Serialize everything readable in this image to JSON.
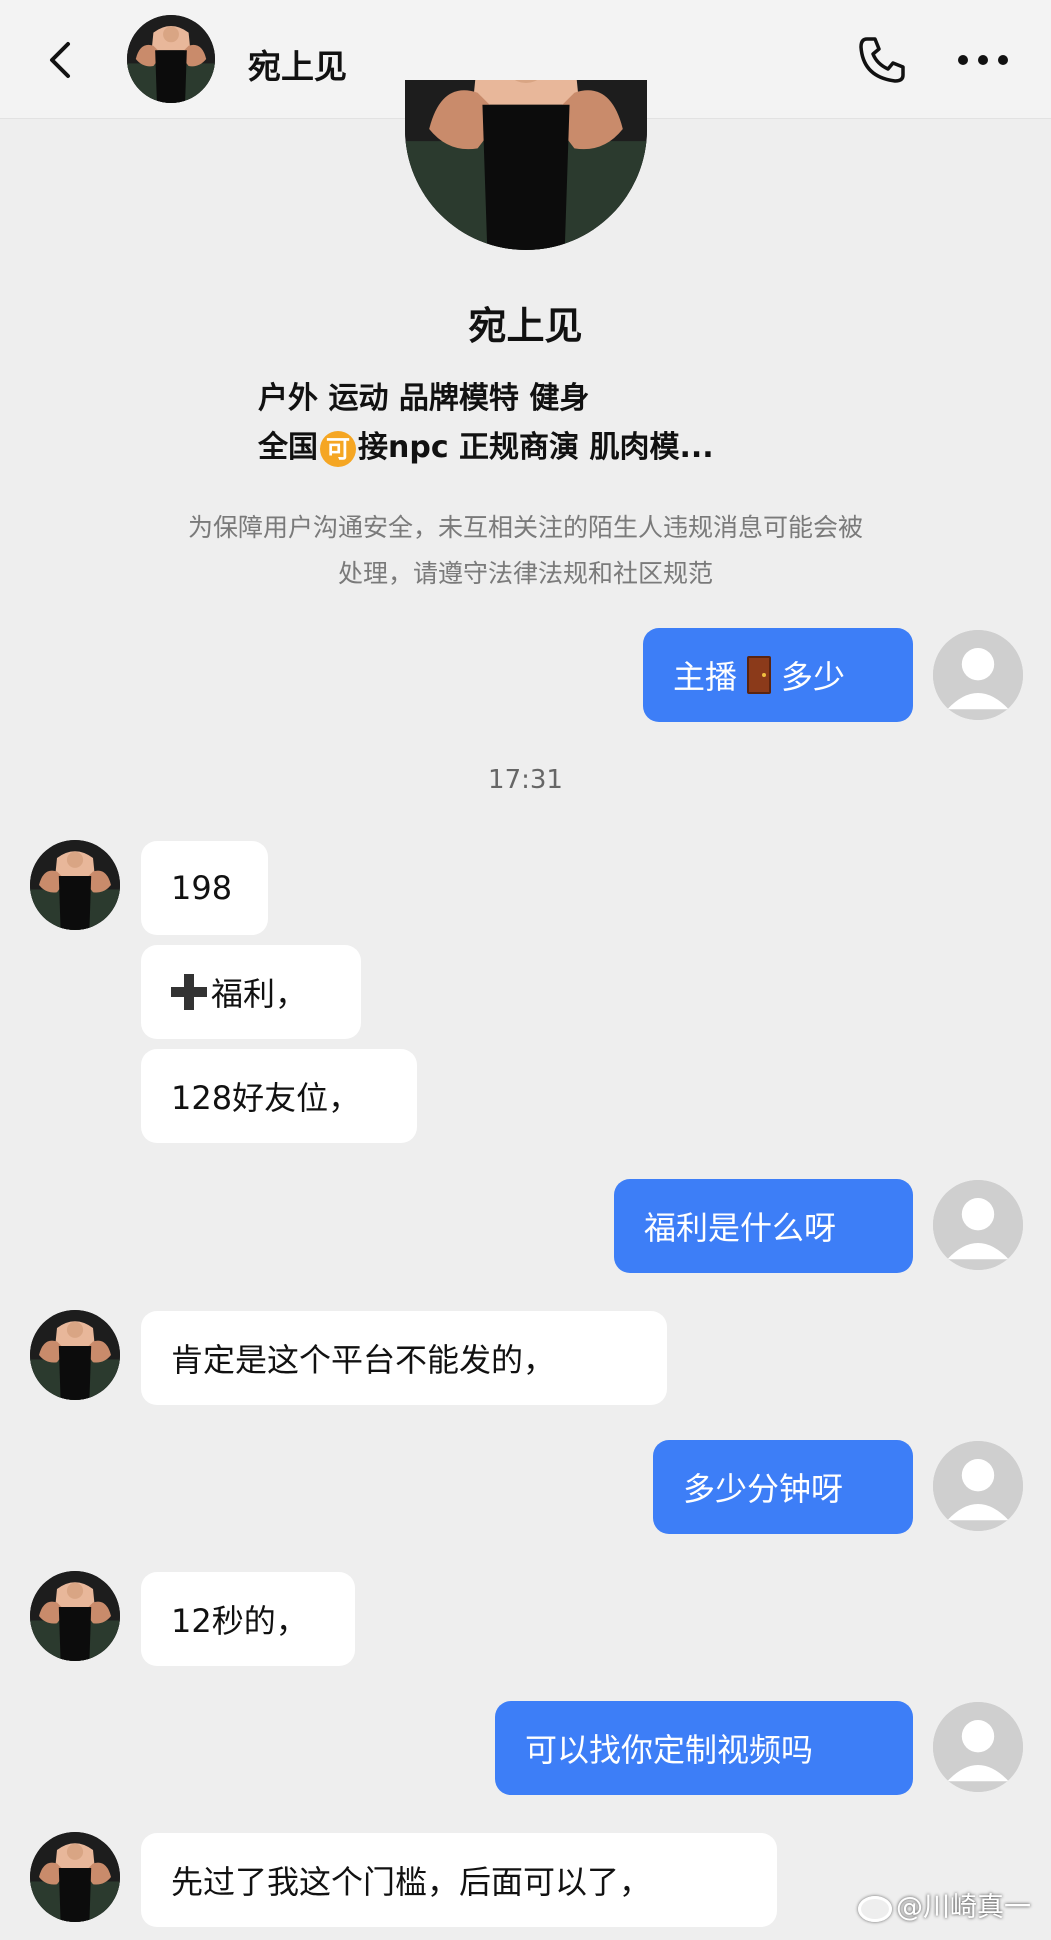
{
  "header": {
    "title": "宛上见",
    "back_icon": "chevron-left-icon",
    "call_icon": "phone-icon",
    "more_icon": "more-dots-icon"
  },
  "profile": {
    "name": "宛上见",
    "bio_line1": "户外 运动 品牌模特 健身",
    "bio_line2_prefix": "全国",
    "bio_badge": "可",
    "bio_line2_suffix": "接npc 正规商演 肌肉模...",
    "badge_color": "#f5a623"
  },
  "notice": {
    "line1": "为保障用户沟通安全，未互相关注的陌生人违规消息可能会被",
    "line2": "处理，请遵守法律法规和社区规范"
  },
  "messages": {
    "m1_before": "主播",
    "m1_after": "多少",
    "time": "17:31",
    "m2": "198",
    "m3": "福利，",
    "m4": "128好友位，",
    "m5": "福利是什么呀",
    "m6": "肯定是这个平台不能发的，",
    "m7": "多少分钟呀",
    "m8": "12秒的，",
    "m9": "可以找你定制视频吗",
    "m10": "先过了我这个门槛，后面可以了，"
  },
  "colors": {
    "outgoing_bubble": "#3d7ef7",
    "incoming_bubble": "#ffffff",
    "background": "#eeeeee"
  },
  "watermark": {
    "text": "@川崎真一"
  }
}
